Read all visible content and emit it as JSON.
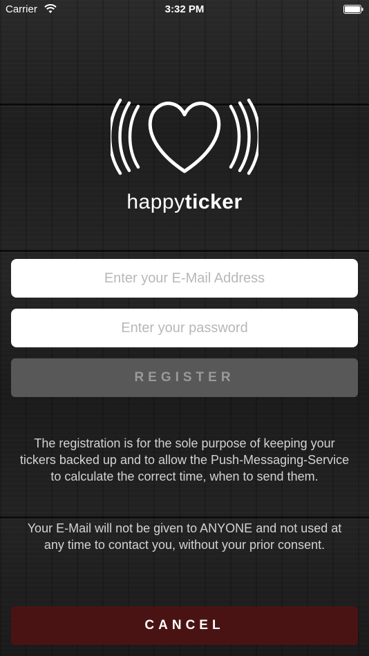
{
  "status_bar": {
    "carrier": "Carrier",
    "time": "3:32 PM"
  },
  "logo": {
    "brand_light": "happy",
    "brand_bold": "ticker"
  },
  "form": {
    "email_placeholder": "Enter your E-Mail Address",
    "password_placeholder": "Enter your password",
    "register_label": "REGISTER"
  },
  "info": {
    "paragraph_1": "The registration is for the sole purpose of keeping your tickers backed up and to allow the Push-Messaging-Service to calculate the correct time, when to send them.",
    "paragraph_2": "Your E-Mail will not be given to ANYONE and not used at any time to contact you, without your prior consent."
  },
  "actions": {
    "cancel_label": "CANCEL"
  },
  "colors": {
    "register_bg": "#585858",
    "cancel_bg": "#4a1313",
    "background": "#1e1e1e"
  },
  "icons": {
    "wifi": "wifi-icon",
    "battery": "battery-icon",
    "logo": "heart-signal-icon"
  }
}
